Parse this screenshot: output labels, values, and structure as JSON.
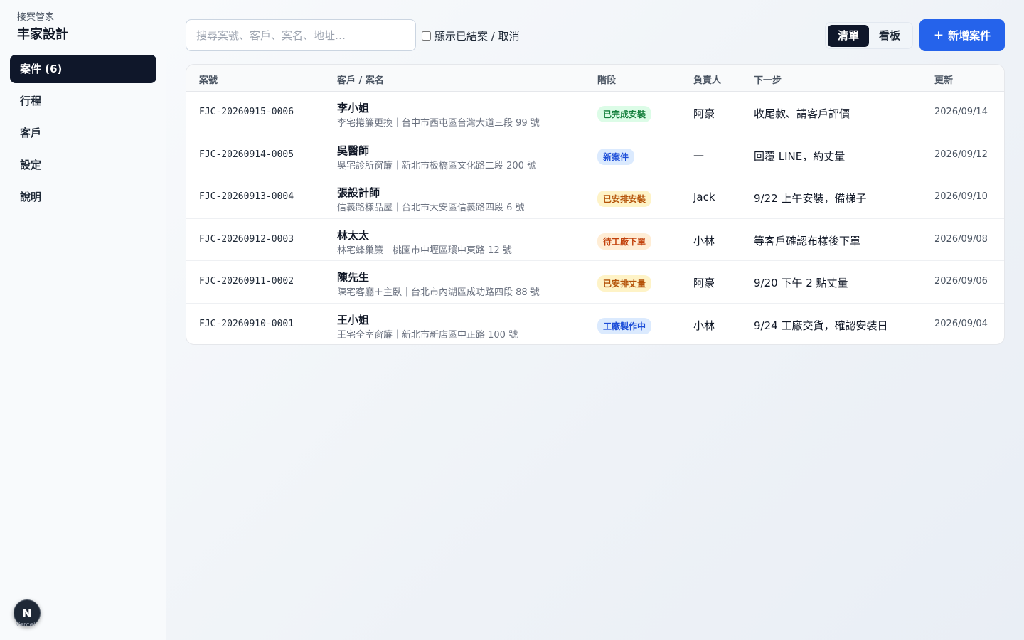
{
  "sidebar": {
    "subtitle": "接案管家",
    "company": "丰家設計",
    "items": [
      {
        "label": "案件 (6)",
        "active": true
      },
      {
        "label": "行程",
        "active": false
      },
      {
        "label": "客戶",
        "active": false
      },
      {
        "label": "設定",
        "active": false
      },
      {
        "label": "說明",
        "active": false
      }
    ],
    "badge_letter": "N",
    "badge_sub": "Vercel"
  },
  "toolbar": {
    "search_placeholder": "搜尋案號、客戶、案名、地址…",
    "search_value": "",
    "show_closed_label": "顯示已結案 / 取消",
    "show_closed_checked": false,
    "view_list": "清單",
    "view_board": "看板",
    "active_view": "list",
    "add_label": "新增案件",
    "add_icon": "+",
    "accent": "#2563eb"
  },
  "table": {
    "headers": {
      "case_id": "案號",
      "client": "客戶 / 案名",
      "stage": "階段",
      "owner": "負責人",
      "next_step": "下一步",
      "updated": "更新"
    },
    "rows": [
      {
        "case_id": "FJC-20260915-0006",
        "client": "李小姐",
        "project": "李宅捲簾更換｜台中市西屯區台灣大道三段 99 號",
        "stage": "已完成安裝",
        "stage_color": "#15803d",
        "stage_bg": "#dcfce7",
        "owner": "阿豪",
        "next_step": "收尾款、請客戶評價",
        "updated": "2026/09/14"
      },
      {
        "case_id": "FJC-20260914-0005",
        "client": "吳醫師",
        "project": "吳宅診所窗簾｜新北市板橋區文化路二段 200 號",
        "stage": "新案件",
        "stage_color": "#1d4ed8",
        "stage_bg": "#dbeafe",
        "owner": "—",
        "next_step": "回覆 LINE，約丈量",
        "updated": "2026/09/12"
      },
      {
        "case_id": "FJC-20260913-0004",
        "client": "張設計師",
        "project": "信義路樣品屋｜台北市大安區信義路四段 6 號",
        "stage": "已安排安裝",
        "stage_color": "#b45309",
        "stage_bg": "#fef3c7",
        "owner": "Jack",
        "next_step": "9/22 上午安裝，備梯子",
        "updated": "2026/09/10"
      },
      {
        "case_id": "FJC-20260912-0003",
        "client": "林太太",
        "project": "林宅蜂巢簾｜桃園市中壢區環中東路 12 號",
        "stage": "待工廠下單",
        "stage_color": "#c2410c",
        "stage_bg": "#ffedd5",
        "owner": "小林",
        "next_step": "等客戶確認布樣後下單",
        "updated": "2026/09/08"
      },
      {
        "case_id": "FJC-20260911-0002",
        "client": "陳先生",
        "project": "陳宅客廳＋主臥｜台北市內湖區成功路四段 88 號",
        "stage": "已安排丈量",
        "stage_color": "#b45309",
        "stage_bg": "#fef3c7",
        "owner": "阿豪",
        "next_step": "9/20 下午 2 點丈量",
        "updated": "2026/09/06"
      },
      {
        "case_id": "FJC-20260910-0001",
        "client": "王小姐",
        "project": "王宅全室窗簾｜新北市新店區中正路 100 號",
        "stage": "工廠製作中",
        "stage_color": "#1d4ed8",
        "stage_bg": "#dbeafe",
        "owner": "小林",
        "next_step": "9/24 工廠交貨，確認安裝日",
        "updated": "2026/09/04"
      }
    ]
  }
}
